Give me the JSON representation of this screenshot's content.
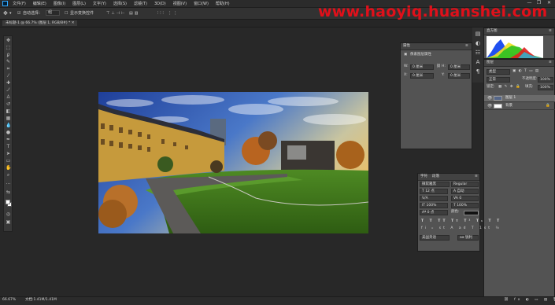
{
  "menubar": {
    "app_logo": "Ps",
    "items": [
      "文件(F)",
      "编辑(E)",
      "图像(I)",
      "图层(L)",
      "文字(Y)",
      "选择(S)",
      "滤镜(T)",
      "3D(D)",
      "视图(V)",
      "窗口(W)",
      "帮助(H)"
    ],
    "window_controls": [
      "—",
      "❐",
      "✕"
    ]
  },
  "options_bar": {
    "tool_icon": "move-icon",
    "auto_select_label": "自动选择：",
    "auto_select_value": "组",
    "transform_label": "显示变换控件"
  },
  "watermark": "www.haoyiq.huanshei.com",
  "document_tab": {
    "label": "未标题-1 @ 66.7% (图层 1, RGB/8#) *"
  },
  "properties_panel": {
    "title": "属性",
    "subtitle": "像素图层属性",
    "w_label": "W:",
    "w_value": "0 厘米",
    "h_label": "H:",
    "h_value": "0 厘米",
    "x_label": "X:",
    "x_value": "0 厘米",
    "y_label": "Y:",
    "y_value": "0 厘米",
    "link_icon": "chain-icon"
  },
  "histogram_panel": {
    "tab": "直方图",
    "channel_colors": [
      "#e02020",
      "#f0e020",
      "#20c020",
      "#2050f0",
      "#20c0e0"
    ]
  },
  "layers_panel": {
    "tab": "图层",
    "kind_label": "类型",
    "blend_mode": "正常",
    "opacity_label": "不透明度:",
    "opacity_value": "100%",
    "lock_label": "锁定:",
    "fill_label": "填充:",
    "fill_value": "100%",
    "layers": [
      {
        "name": "图层 1",
        "selected": true,
        "thumb_color": "#556688"
      },
      {
        "name": "背景",
        "selected": false,
        "thumb_color": "#ffffff"
      }
    ]
  },
  "character_panel": {
    "tabs": [
      "字符",
      "段落"
    ],
    "font_family": "微软雅黑",
    "font_style": "Regular",
    "size_value": "12 点",
    "leading_value": "自动",
    "tracking_value": "0",
    "scale_v": "100%",
    "scale_h": "100%",
    "baseline": "0 点",
    "color_label": "颜色:",
    "language": "美国英语",
    "aa": "锐利"
  },
  "status_bar": {
    "zoom": "66.67%",
    "doc_info": "文档:1.41M/1.41M"
  },
  "canvas": {
    "description_colors": {
      "sky": "#3d5fb0",
      "grass": "#3f7a1e",
      "building": "#c8a040"
    }
  }
}
